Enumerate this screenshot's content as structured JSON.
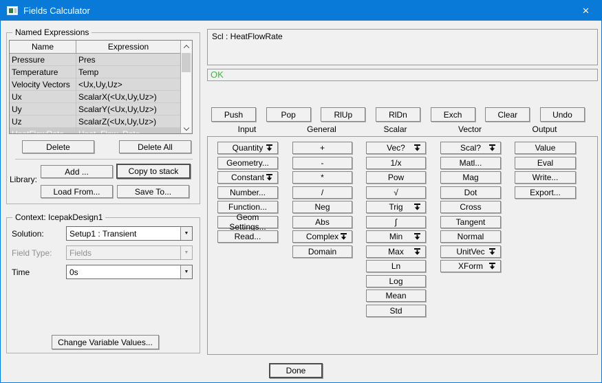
{
  "window": {
    "title": "Fields Calculator"
  },
  "icons": {
    "window_icon": "fields-calculator-app-icon",
    "close_glyph": "×",
    "combo_arrow_glyph": "▼",
    "menu_icon": "down-arrow-to-stack"
  },
  "named_expressions": {
    "group_label": "Named Expressions",
    "columns": {
      "name": "Name",
      "expression": "Expression"
    },
    "rows": [
      [
        "Pressure",
        "Pres"
      ],
      [
        "Temperature",
        "Temp"
      ],
      [
        "Velocity Vectors",
        "<Ux,Uy,Uz>"
      ],
      [
        "Ux",
        "ScalarX(<Ux,Uy,Uz>)"
      ],
      [
        "Uy",
        "ScalarY(<Ux,Uy,Uz>)"
      ],
      [
        "Uz",
        "ScalarZ(<Ux,Uy,Uz>)"
      ],
      [
        "HeatFlowRate",
        "Heat_Flow_Rate"
      ]
    ],
    "selected_index": 6,
    "delete_label": "Delete",
    "delete_all_label": "Delete All",
    "library_label": "Library:",
    "add_label": "Add ...",
    "copy_to_stack_label": "Copy to stack",
    "load_from_label": "Load From...",
    "save_to_label": "Save To..."
  },
  "context": {
    "group_label": "Context: IcepakDesign1",
    "solution_label": "Solution:",
    "solution_value": "Setup1 : Transient",
    "field_type_label": "Field Type:",
    "field_type_value": "Fields",
    "time_label": "Time",
    "time_value": "0s",
    "change_values_label": "Change Variable Values..."
  },
  "stack": {
    "display_text": "Scl : HeatFlowRate",
    "status_text": "OK",
    "status_color": "#3cb83c"
  },
  "stack_buttons": [
    "Push",
    "Pop",
    "RlUp",
    "RlDn",
    "Exch",
    "Clear",
    "Undo"
  ],
  "calculator": {
    "columns": [
      {
        "label": "Input",
        "buttons": [
          {
            "label": "Quantity",
            "menu": true
          },
          {
            "label": "Geometry..."
          },
          {
            "label": "Constant",
            "menu": true
          },
          {
            "label": "Number..."
          },
          {
            "label": "Function..."
          },
          {
            "label": "Geom Settings..."
          },
          {
            "label": "Read..."
          }
        ]
      },
      {
        "label": "General",
        "buttons": [
          {
            "label": "+"
          },
          {
            "label": "-"
          },
          {
            "label": "*"
          },
          {
            "label": "/"
          },
          {
            "label": "Neg"
          },
          {
            "label": "Abs"
          },
          {
            "label": "Complex",
            "menu": true
          },
          {
            "label": "Domain"
          }
        ]
      },
      {
        "label": "Scalar",
        "buttons": [
          {
            "label": "Vec?",
            "menu": true
          },
          {
            "label": "1/x"
          },
          {
            "label": "Pow"
          },
          {
            "label": "√"
          },
          {
            "label": "Trig",
            "menu": true
          },
          {
            "label": "∫"
          },
          {
            "label": "Min",
            "menu": true
          },
          {
            "label": "Max",
            "menu": true
          },
          {
            "label": "Ln"
          },
          {
            "label": "Log"
          },
          {
            "label": "Mean"
          },
          {
            "label": "Std"
          }
        ]
      },
      {
        "label": "Vector",
        "buttons": [
          {
            "label": "Scal?",
            "menu": true
          },
          {
            "label": "Matl..."
          },
          {
            "label": "Mag"
          },
          {
            "label": "Dot"
          },
          {
            "label": "Cross"
          },
          {
            "label": "Tangent"
          },
          {
            "label": "Normal"
          },
          {
            "label": "UnitVec",
            "menu": true
          },
          {
            "label": "XForm",
            "menu": true
          }
        ]
      },
      {
        "label": "Output",
        "buttons": [
          {
            "label": "Value"
          },
          {
            "label": "Eval"
          },
          {
            "label": "Write..."
          },
          {
            "label": "Export..."
          }
        ]
      }
    ]
  },
  "done_label": "Done"
}
